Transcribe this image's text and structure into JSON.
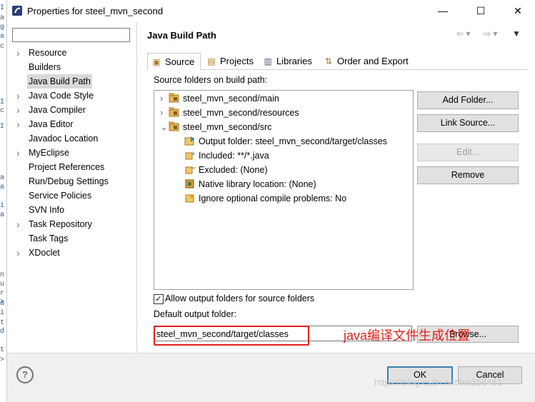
{
  "window": {
    "title": "Properties for steel_mvn_second",
    "controls": [
      "—",
      "☐",
      "✕"
    ]
  },
  "left_bleed": [
    "I",
    "a",
    "g",
    "a",
    "c",
    "I",
    "c",
    "I",
    "a",
    "a",
    "i",
    "a",
    "a",
    "i",
    "t",
    "d",
    "n",
    "u",
    "r",
    ">",
    "t",
    ">"
  ],
  "sidebar": {
    "filter_value": "",
    "items": [
      {
        "label": "Resource",
        "expandable": true
      },
      {
        "label": "Builders",
        "expandable": false
      },
      {
        "label": "Java Build Path",
        "expandable": false,
        "selected": true
      },
      {
        "label": "Java Code Style",
        "expandable": true
      },
      {
        "label": "Java Compiler",
        "expandable": true
      },
      {
        "label": "Java Editor",
        "expandable": true
      },
      {
        "label": "Javadoc Location",
        "expandable": false
      },
      {
        "label": "MyEclipse",
        "expandable": true
      },
      {
        "label": "Project References",
        "expandable": false
      },
      {
        "label": "Run/Debug Settings",
        "expandable": false
      },
      {
        "label": "Service Policies",
        "expandable": false
      },
      {
        "label": "SVN Info",
        "expandable": false
      },
      {
        "label": "Task Repository",
        "expandable": true
      },
      {
        "label": "Task Tags",
        "expandable": false
      },
      {
        "label": "XDoclet",
        "expandable": true
      }
    ]
  },
  "main": {
    "header": "Java Build Path",
    "tabs": [
      {
        "label": "Source",
        "icon": "source-folder-icon",
        "active": true
      },
      {
        "label": "Projects",
        "icon": "projects-icon",
        "active": false
      },
      {
        "label": "Libraries",
        "icon": "libraries-icon",
        "active": false
      },
      {
        "label": "Order and Export",
        "icon": "order-export-icon",
        "active": false
      }
    ],
    "source_label": "Source folders on build path:",
    "source_tree": [
      {
        "label": "steel_mvn_second/main",
        "level": 0,
        "arrow": "›"
      },
      {
        "label": "steel_mvn_second/resources",
        "level": 0,
        "arrow": "›"
      },
      {
        "label": "steel_mvn_second/src",
        "level": 0,
        "arrow": "⌄"
      },
      {
        "label": "Output folder: steel_mvn_second/target/classes",
        "level": 1,
        "icon": "output-folder-icon"
      },
      {
        "label": "Included: **/*.java",
        "level": 1,
        "icon": "included-icon"
      },
      {
        "label": "Excluded: (None)",
        "level": 1,
        "icon": "excluded-icon"
      },
      {
        "label": "Native library location: (None)",
        "level": 1,
        "icon": "native-library-icon"
      },
      {
        "label": "Ignore optional compile problems: No",
        "level": 1,
        "icon": "ignore-problems-icon"
      }
    ],
    "buttons": {
      "add_folder": "Add Folder...",
      "link_source": "Link Source...",
      "edit": "Edit...",
      "remove": "Remove",
      "browse": "Browse..."
    },
    "allow_output_label": "Allow output folders for source folders",
    "allow_output_checked": true,
    "default_output_label": "Default output folder:",
    "default_output_value": "steel_mvn_second/target/classes",
    "annotation": "java编译文件生成位置"
  },
  "footer": {
    "help": "?",
    "ok": "OK",
    "cancel": "Cancel",
    "watermark": "https://blog.csdn.net/wx356481"
  },
  "colors": {
    "annotation_red": "#e0201b",
    "selection_bg": "#d9d9d9",
    "folder_brown": "#b07b1e"
  }
}
